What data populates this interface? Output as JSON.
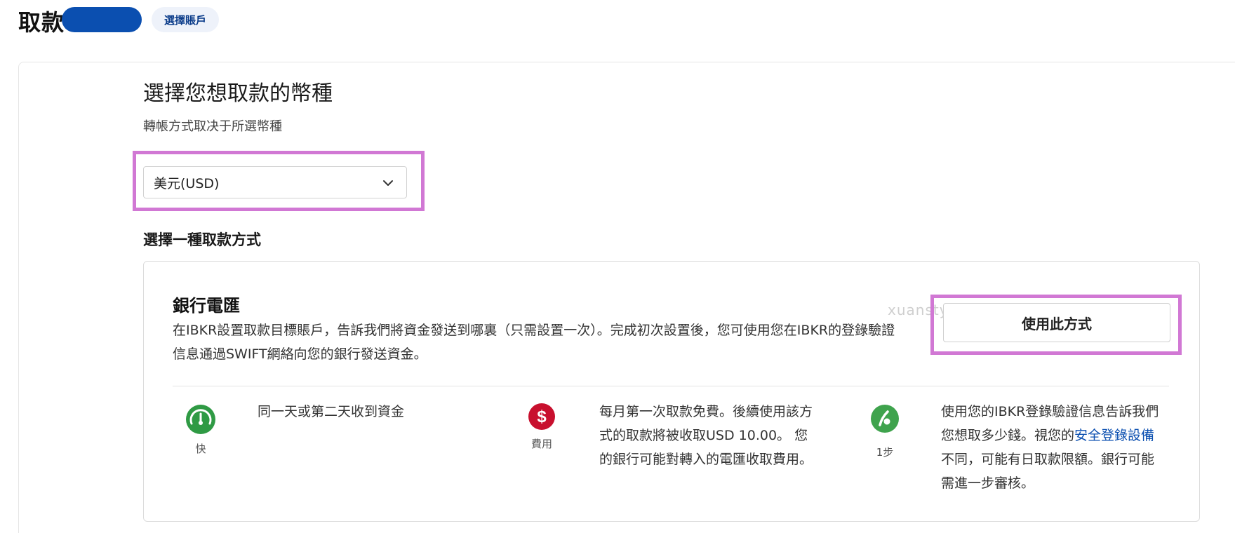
{
  "header": {
    "title": "取款",
    "account_label": "選擇賬戶"
  },
  "currency": {
    "heading": "選擇您想取款的幣種",
    "subheading": "轉帳方式取决于所選幣種",
    "selected": "美元(USD)"
  },
  "method_section": {
    "heading": "選擇一種取款方式"
  },
  "method": {
    "title": "銀行電匯",
    "description": "在IBKR設置取款目標賬戶，告訴我們將資金發送到哪裏（只需設置一次）。完成初次設置後，您可使用您在IBKR的登錄驗證信息通過SWIFT網絡向您的銀行發送資金。",
    "use_button": "使用此方式",
    "watermark": "xuanstyl.com"
  },
  "features": {
    "speed": {
      "icon": "speedometer-icon",
      "caption": "快",
      "text": "同一天或第二天收到資金"
    },
    "fee": {
      "icon": "dollar-icon",
      "caption": "費用",
      "text": "每月第一次取款免費。後續使用該方式的取款將被收取USD 10.00。 您的銀行可能對轉入的電匯收取費用。"
    },
    "steps": {
      "icon": "step-icon",
      "caption": "1步",
      "text_before": "使用您的IBKR登錄驗證信息告訴我們您想取多少錢。視您的",
      "link": "安全登錄設備",
      "text_after": "不同，可能有日取款限額。銀行可能需進一步審核。"
    }
  },
  "colors": {
    "brand_blue": "#0b4fb0",
    "highlight_pink": "#d178d4",
    "speed_green": "#2f9a44",
    "fee_red": "#c8102e",
    "step_green": "#3fa34d"
  }
}
